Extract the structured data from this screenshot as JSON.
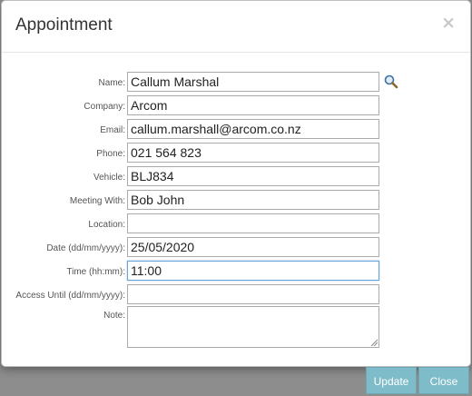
{
  "dialog": {
    "title": "Appointment",
    "close_glyph": "×"
  },
  "form": {
    "fields": [
      {
        "label": "Name:",
        "value": "Callum Marshal"
      },
      {
        "label": "Company:",
        "value": "Arcom"
      },
      {
        "label": "Email:",
        "value": "callum.marshall@arcom.co.nz"
      },
      {
        "label": "Phone:",
        "value": "021 564 823"
      },
      {
        "label": "Vehicle:",
        "value": "BLJ834"
      },
      {
        "label": "Meeting With:",
        "value": "Bob John"
      },
      {
        "label": "Location:",
        "value": ""
      },
      {
        "label": "Date (dd/mm/yyyy):",
        "value": "25/05/2020"
      },
      {
        "label": "Time (hh:mm):",
        "value": "11:00"
      },
      {
        "label": "Access Until (dd/mm/yyyy):",
        "value": ""
      },
      {
        "label": "Note:",
        "value": ""
      }
    ],
    "search_icon": "search-icon"
  },
  "buttons": {
    "update_label": "Update",
    "close_label": "Close"
  },
  "colors": {
    "button_bg": "#7fbcc9",
    "overlay": "#8d8d8d",
    "focus_border": "#66a3d8"
  }
}
